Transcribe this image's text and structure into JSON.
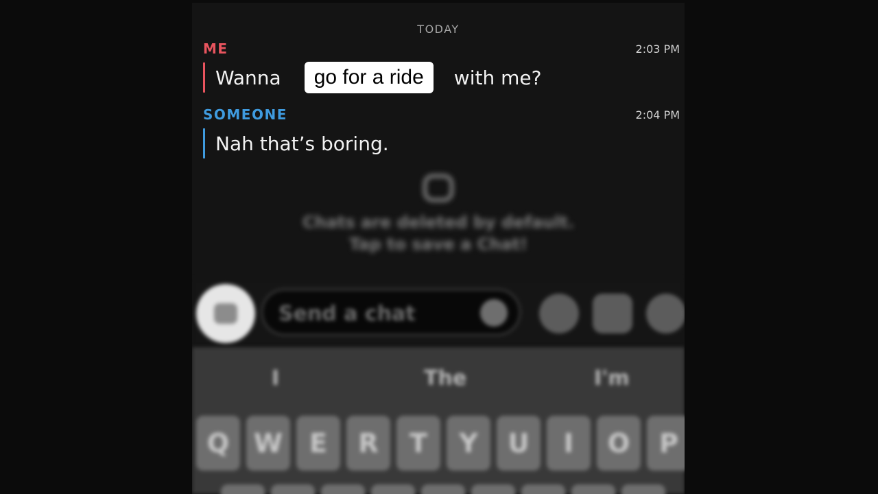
{
  "chat": {
    "day_label": "TODAY",
    "messages": [
      {
        "sender": "ME",
        "time": "2:03 PM",
        "text_before": "Wanna",
        "highlight": "go for a ride",
        "text_after": "with me?"
      },
      {
        "sender": "SOMEONE",
        "time": "2:04 PM",
        "text": "Nah that’s boring."
      }
    ],
    "info_lines": [
      "Chats are deleted by default.",
      "Tap to save a Chat!"
    ]
  },
  "input": {
    "placeholder": "Send a chat"
  },
  "keyboard": {
    "suggestions": [
      "I",
      "The",
      "I'm"
    ],
    "keys": [
      "Q",
      "W",
      "E",
      "R",
      "T",
      "Y",
      "U",
      "I",
      "O",
      "P"
    ]
  },
  "colors": {
    "me": "#e8545e",
    "someone": "#3f9bdf",
    "highlight_bg": "#ffffff"
  }
}
